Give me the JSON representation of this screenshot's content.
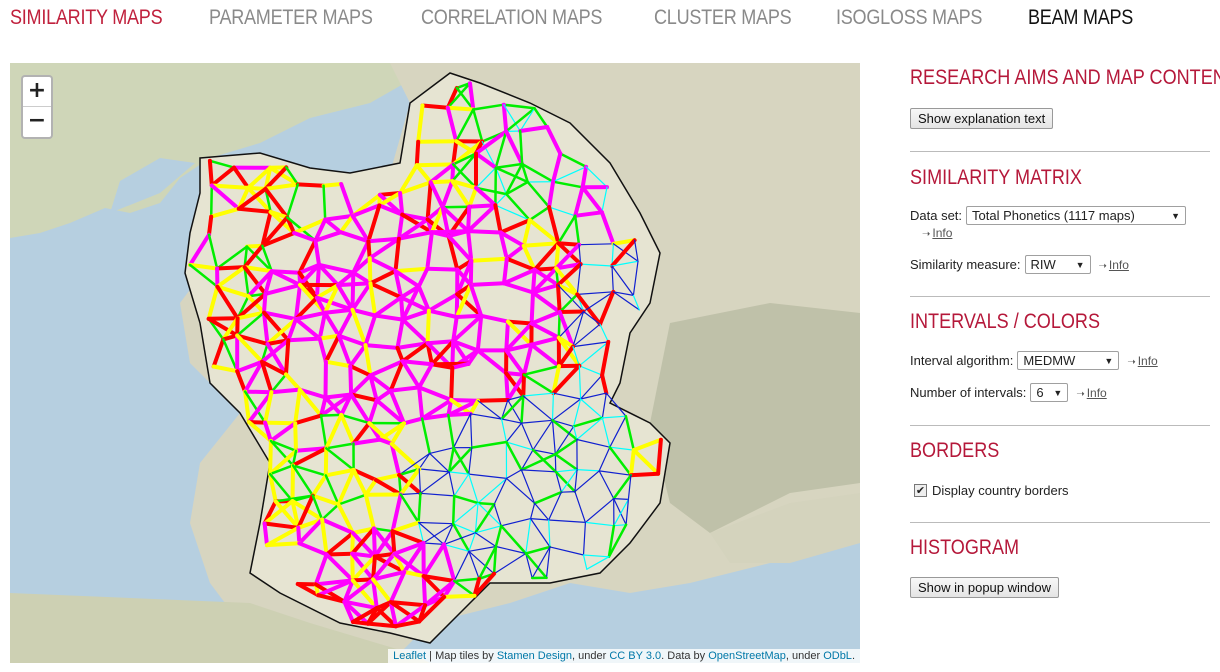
{
  "nav": {
    "tabs": [
      "SIMILARITY MAPS",
      "PARAMETER MAPS",
      "CORRELATION MAPS",
      "CLUSTER MAPS",
      "ISOGLOSS MAPS",
      "BEAM MAPS"
    ]
  },
  "map": {
    "zoom_in": "+",
    "zoom_out": "−",
    "attribution": {
      "leaflet": "Leaflet",
      "sep1": " | Map tiles by ",
      "stamen": "Stamen Design",
      "sep2": ", under ",
      "ccby": "CC BY 3.0",
      "sep3": ". Data by ",
      "osm": "OpenStreetMap",
      "sep4": ", under ",
      "odbl": "ODbL",
      "end": "."
    },
    "colors": {
      "sea": "#b6cfe0",
      "land": "#d9d7c4",
      "france": "#e3e0cf",
      "magenta": "#ff00ff",
      "red": "#ff0000",
      "yellow": "#ffff00",
      "green": "#00ee00",
      "cyan": "#00ffff",
      "blue": "#1020d0"
    }
  },
  "sidebar": {
    "research": {
      "title": "RESEARCH AIMS AND MAP CONTENTS",
      "button": "Show explanation text"
    },
    "matrix": {
      "title": "SIMILARITY MATRIX",
      "dataset_label": "Data set:",
      "dataset_value": "Total Phonetics (1117 maps)",
      "info": "Info",
      "measure_label": "Similarity measure:",
      "measure_value": "RIW"
    },
    "intervals": {
      "title": "INTERVALS / COLORS",
      "algo_label": "Interval algorithm:",
      "algo_value": "MEDMW",
      "count_label": "Number of intervals:",
      "count_value": "6",
      "info": "Info"
    },
    "borders": {
      "title": "BORDERS",
      "checkbox_label": "Display country borders",
      "checked": true
    },
    "histogram": {
      "title": "HISTOGRAM",
      "button": "Show in popup window"
    }
  }
}
